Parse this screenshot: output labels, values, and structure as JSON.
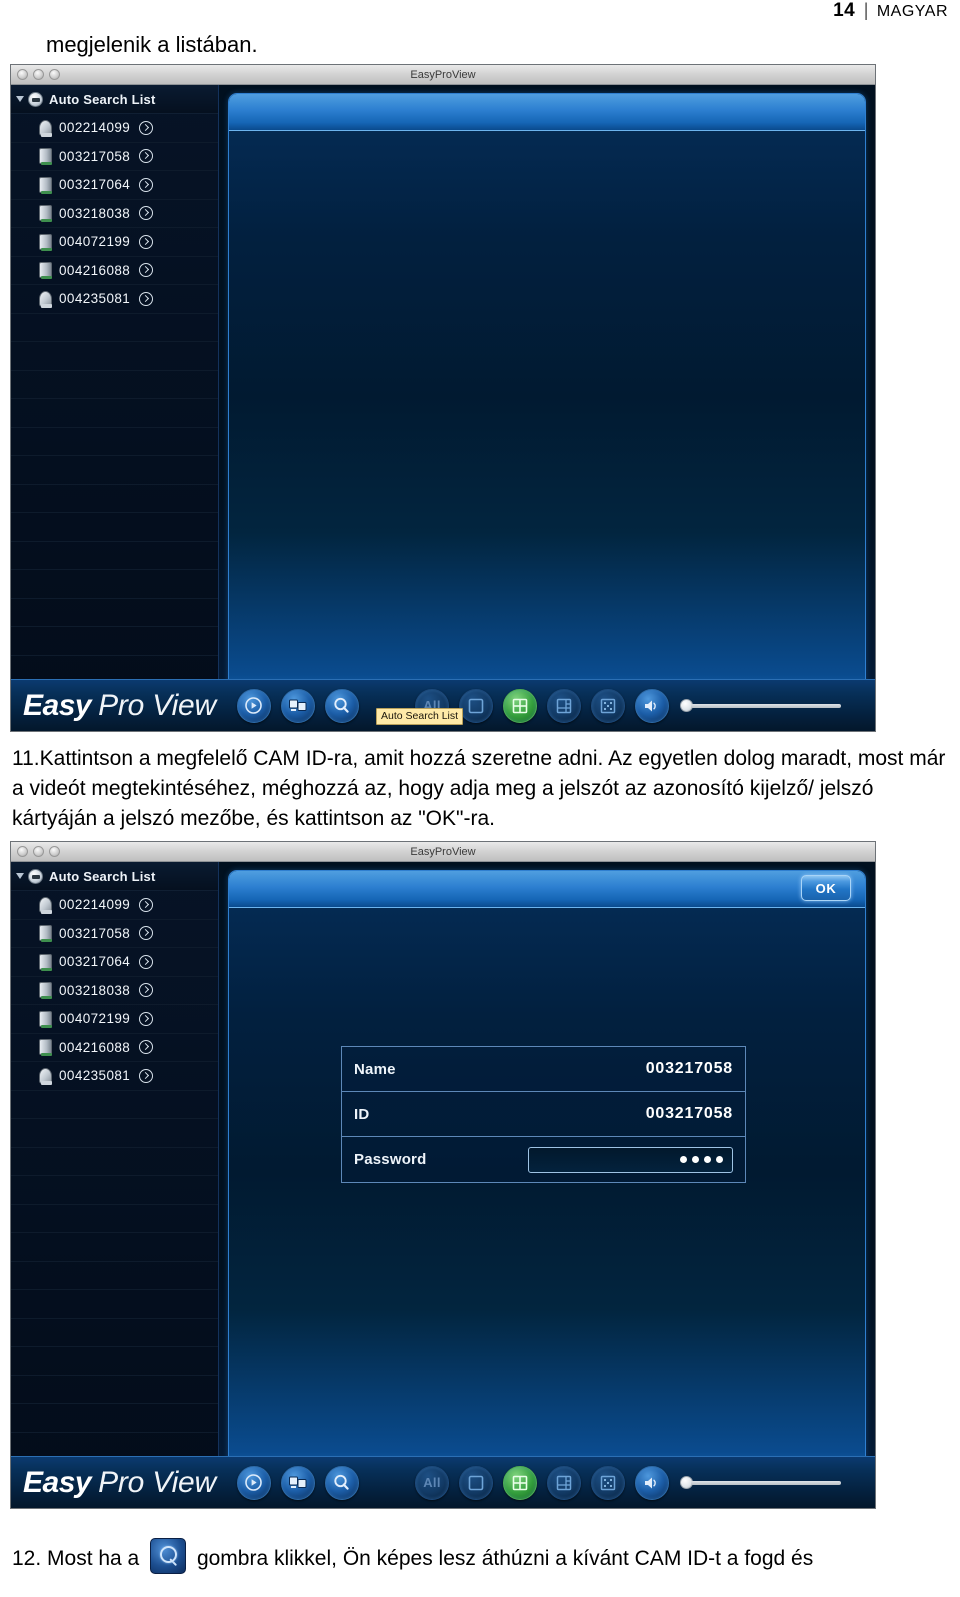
{
  "page_header": {
    "page_number": "14",
    "separator": "|",
    "language": "MAGYAR"
  },
  "paragraphs": {
    "lead": "megjelenik a listában.",
    "step_11": "11.Kattintson a megfelelő CAM ID-ra, amit hozzá szeretne adni. Az egyetlen dolog maradt, most már a videót megtekintéséhez,     méghozzá az, hogy adja meg a jelszót az azonosító kijelző/ jelszó kártyáján a jelszó mezőbe, és kattintson az \"OK\"-ra.",
    "step_12_before": "12. Most ha a",
    "step_12_after": "gombra klikkel, Ön képes lesz áthúzni a kívánt CAM ID-t a fogd és"
  },
  "window": {
    "title": "EasyProView",
    "traffic_lights": [
      "close-button",
      "minimize-button",
      "zoom-button"
    ]
  },
  "sidebar": {
    "root_label": "Auto Search List",
    "root_icon": "folder-disc-icon",
    "disclosure_icon": "disclosure-triangle-open",
    "cameras": [
      {
        "id": "002214099",
        "icon": "dome-camera-icon"
      },
      {
        "id": "003217058",
        "icon": "box-camera-icon"
      },
      {
        "id": "003217064",
        "icon": "box-camera-icon"
      },
      {
        "id": "003218038",
        "icon": "box-camera-icon"
      },
      {
        "id": "004072199",
        "icon": "box-camera-icon"
      },
      {
        "id": "004216088",
        "icon": "box-camera-icon"
      },
      {
        "id": "004235081",
        "icon": "dome-camera-icon"
      }
    ],
    "empty_row_count": 13
  },
  "toolbar": {
    "logo_primary": "Easy",
    "logo_secondary": "Pro View",
    "buttons": [
      {
        "name": "playback-button",
        "icon": "play-circle-icon",
        "state": "normal"
      },
      {
        "name": "camera-manager-button",
        "icon": "dual-screen-icon",
        "state": "normal"
      },
      {
        "name": "auto-search-button",
        "icon": "search-magnifier-icon",
        "state": "active"
      }
    ],
    "layout_buttons": [
      {
        "name": "layout-all-button",
        "label": "All",
        "icon": "all-text-icon",
        "state": "dim"
      },
      {
        "name": "layout-single-button",
        "label": "",
        "icon": "single-pane-icon",
        "state": "dim"
      },
      {
        "name": "layout-quad-button",
        "label": "",
        "icon": "quad-grid-icon",
        "state": "active-green"
      },
      {
        "name": "layout-six-button",
        "label": "",
        "icon": "six-pane-icon",
        "state": "dim"
      },
      {
        "name": "layout-nine-button",
        "label": "",
        "icon": "nine-spot-icon",
        "state": "dim"
      }
    ],
    "volume": {
      "name": "volume-control",
      "icon": "speaker-icon",
      "value_percent": 0
    },
    "tooltip": "Auto Search List"
  },
  "login_dialog": {
    "ok_label": "OK",
    "fields": [
      {
        "label": "Name",
        "value": "003217058",
        "type": "readonly"
      },
      {
        "label": "ID",
        "value": "003217058",
        "type": "readonly"
      },
      {
        "label": "Password",
        "value": "••••",
        "masked_char_count": 4,
        "type": "password"
      }
    ]
  },
  "colors": {
    "accent_blue": "#2f7fd0",
    "panel_navy": "#01172c",
    "active_green": "#35a03d",
    "tooltip_yellow": "#ffeaa8"
  }
}
